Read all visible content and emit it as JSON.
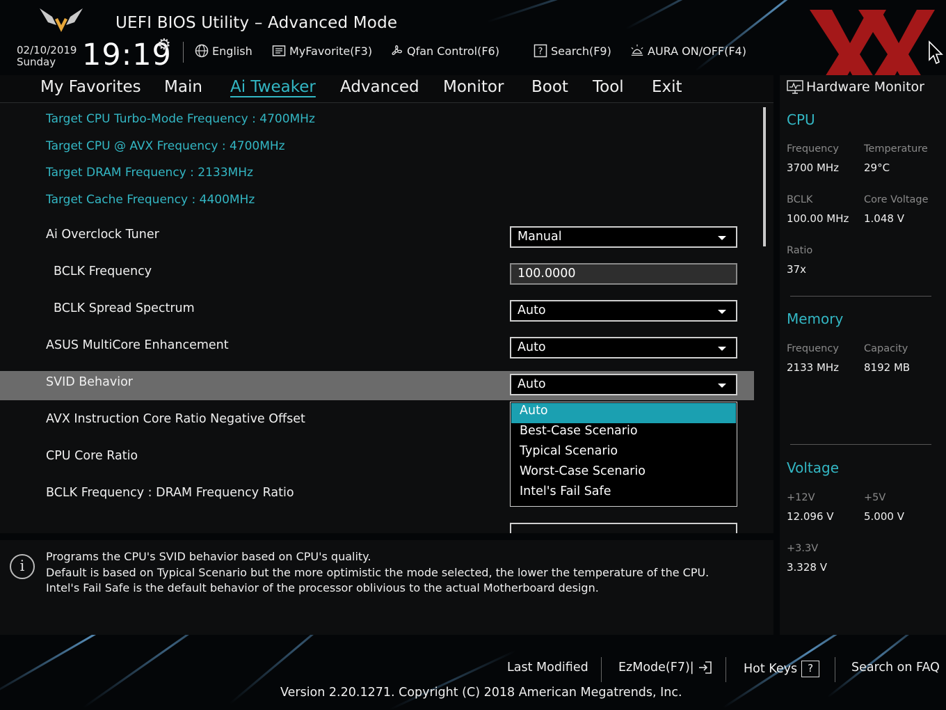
{
  "header": {
    "title": "UEFI BIOS Utility – Advanced Mode",
    "date": "02/10/2019",
    "weekday": "Sunday",
    "time": "19:19",
    "settings_icon": "gear-icon",
    "tools": [
      {
        "label": "English",
        "icon": "globe-icon"
      },
      {
        "label": "MyFavorite(F3)",
        "icon": "favorite-list-icon"
      },
      {
        "label": "Qfan Control(F6)",
        "icon": "fan-icon"
      },
      {
        "label": "Search(F9)",
        "icon": "search-box-icon"
      },
      {
        "label": "AURA ON/OFF(F4)",
        "icon": "aura-light-icon"
      }
    ],
    "accent_color": "#33b7c4",
    "watermark_color": "#c01c1c"
  },
  "menu": {
    "items": [
      "My Favorites",
      "Main",
      "Ai Tweaker",
      "Advanced",
      "Monitor",
      "Boot",
      "Tool",
      "Exit"
    ],
    "active": "Ai Tweaker"
  },
  "main": {
    "info_rows": [
      "Target CPU Turbo-Mode Frequency : 4700MHz",
      "Target CPU @ AVX Frequency : 4700MHz",
      "Target DRAM Frequency : 2133MHz",
      "Target Cache Frequency : 4400MHz"
    ],
    "settings": [
      {
        "label": "Ai Overclock Tuner",
        "value": "Manual"
      },
      {
        "label": "BCLK Frequency",
        "value": "100.0000"
      },
      {
        "label": "BCLK Spread Spectrum",
        "value": "Auto"
      },
      {
        "label": "ASUS MultiCore Enhancement",
        "value": "Auto"
      },
      {
        "label": "SVID Behavior",
        "value": "Auto"
      },
      {
        "label": "AVX Instruction Core Ratio Negative Offset",
        "value": ""
      },
      {
        "label": "CPU Core Ratio",
        "value": ""
      },
      {
        "label": "BCLK Frequency : DRAM Frequency Ratio",
        "value": ""
      }
    ],
    "highlighted_setting": "SVID Behavior",
    "popup_options": [
      "Auto",
      "Best-Case Scenario",
      "Typical Scenario",
      "Worst-Case Scenario",
      "Intel's Fail Safe"
    ],
    "popup_selected": "Auto"
  },
  "description": {
    "icon": "info-icon",
    "lines": [
      "Programs the CPU's SVID behavior based on CPU's quality.",
      "Default is based on Typical Scenario but the more optimistic the mode selected, the lower the temperature of the CPU.",
      "Intel's Fail Safe is the default behavior of the processor oblivious to the actual Motherboard design."
    ]
  },
  "hardware_monitor": {
    "title": "Hardware Monitor",
    "icon": "monitor-icon",
    "cpu": {
      "heading": "CPU",
      "frequency_label": "Frequency",
      "frequency": "3700 MHz",
      "temperature_label": "Temperature",
      "temperature": "29°C",
      "bclk_label": "BCLK",
      "bclk": "100.00 MHz",
      "core_voltage_label": "Core Voltage",
      "core_voltage": "1.048 V",
      "ratio_label": "Ratio",
      "ratio": "37x"
    },
    "memory": {
      "heading": "Memory",
      "frequency_label": "Frequency",
      "frequency": "2133 MHz",
      "capacity_label": "Capacity",
      "capacity": "8192 MB"
    },
    "voltage": {
      "heading": "Voltage",
      "v12_label": "+12V",
      "v12": "12.096 V",
      "v5_label": "+5V",
      "v5": "5.000 V",
      "v33_label": "+3.3V",
      "v33": "3.328 V"
    }
  },
  "footer": {
    "last_modified": "Last Modified",
    "ezmode": "EzMode(F7)|",
    "hot_keys": "Hot Keys",
    "hot_keys_key": "?",
    "search_faq": "Search on FAQ",
    "version": "Version 2.20.1271. Copyright (C) 2018 American Megatrends, Inc."
  }
}
